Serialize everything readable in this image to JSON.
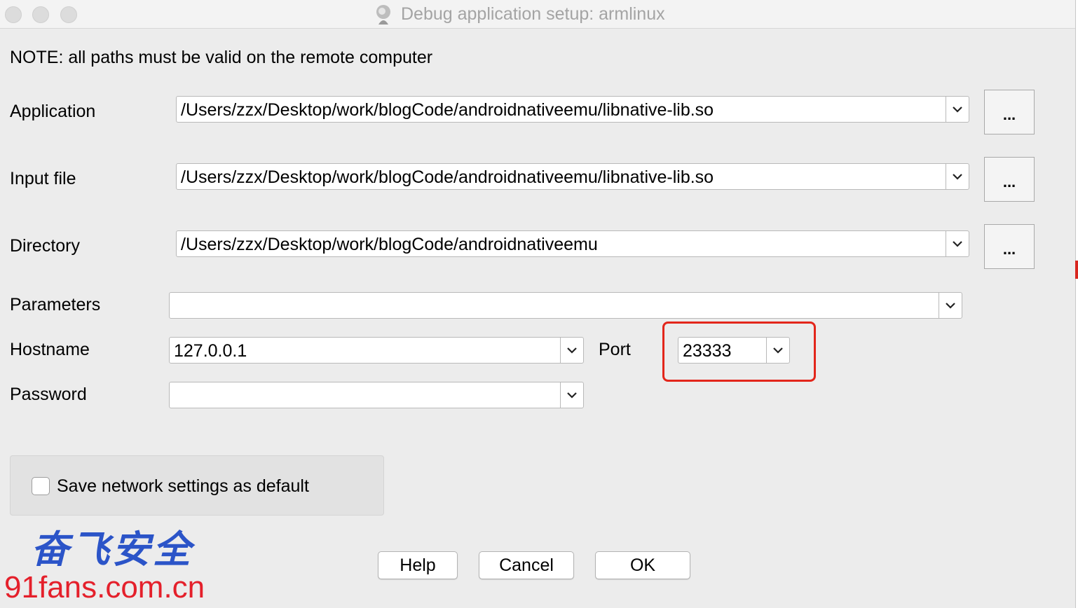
{
  "window": {
    "title": "Debug application setup: armlinux"
  },
  "note": "NOTE: all paths must be valid on the remote computer",
  "fields": {
    "application": {
      "label": "Application",
      "value": "/Users/zzx/Desktop/work/blogCode/androidnativeemu/libnative-lib.so"
    },
    "input_file": {
      "label": "Input file",
      "value": "/Users/zzx/Desktop/work/blogCode/androidnativeemu/libnative-lib.so"
    },
    "directory": {
      "label": "Directory",
      "value": "/Users/zzx/Desktop/work/blogCode/androidnativeemu"
    },
    "parameters": {
      "label": "Parameters",
      "value": ""
    },
    "hostname": {
      "label": "Hostname",
      "value": "127.0.0.1"
    },
    "port": {
      "label": "Port",
      "value": "23333"
    },
    "password": {
      "label": "Password",
      "value": ""
    }
  },
  "browse_label": "...",
  "save_default": {
    "label": "Save network settings as default",
    "checked": false
  },
  "buttons": {
    "help": "Help",
    "cancel": "Cancel",
    "ok": "OK"
  },
  "watermark": {
    "chinese": "奋飞安全",
    "url": "91fans.com.cn"
  },
  "colors": {
    "highlight": "#e3261b",
    "watermark_cn": "#2b54c8",
    "watermark_url": "#e4202b"
  }
}
